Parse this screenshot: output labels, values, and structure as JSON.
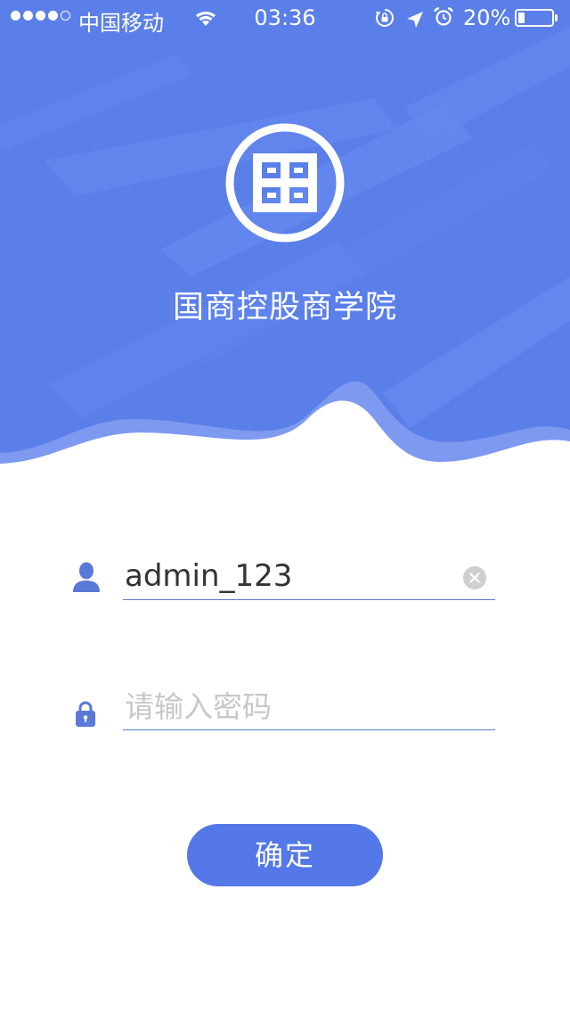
{
  "status_bar": {
    "carrier": "中国移动",
    "time": "03:36",
    "battery_percent": "20%",
    "battery_level": 0.2,
    "signal_bars_filled": 4,
    "signal_bars_total": 5,
    "icons": [
      "wifi-icon",
      "rotation-lock-icon",
      "location-icon",
      "alarm-icon",
      "battery-icon"
    ]
  },
  "brand": {
    "title": "国商控股商学院",
    "logo": "brand-logo"
  },
  "login_form": {
    "username": {
      "value": "admin_123",
      "icon": "user-icon",
      "clear_icon": "clear-icon"
    },
    "password": {
      "placeholder": "请输入密码",
      "value": "",
      "icon": "lock-icon"
    },
    "confirm_label": "确定"
  },
  "colors": {
    "primary": "#5478e8",
    "hero_background": "#5a7fe9",
    "underline": "#5a78d6",
    "placeholder": "#c8c8c8"
  }
}
